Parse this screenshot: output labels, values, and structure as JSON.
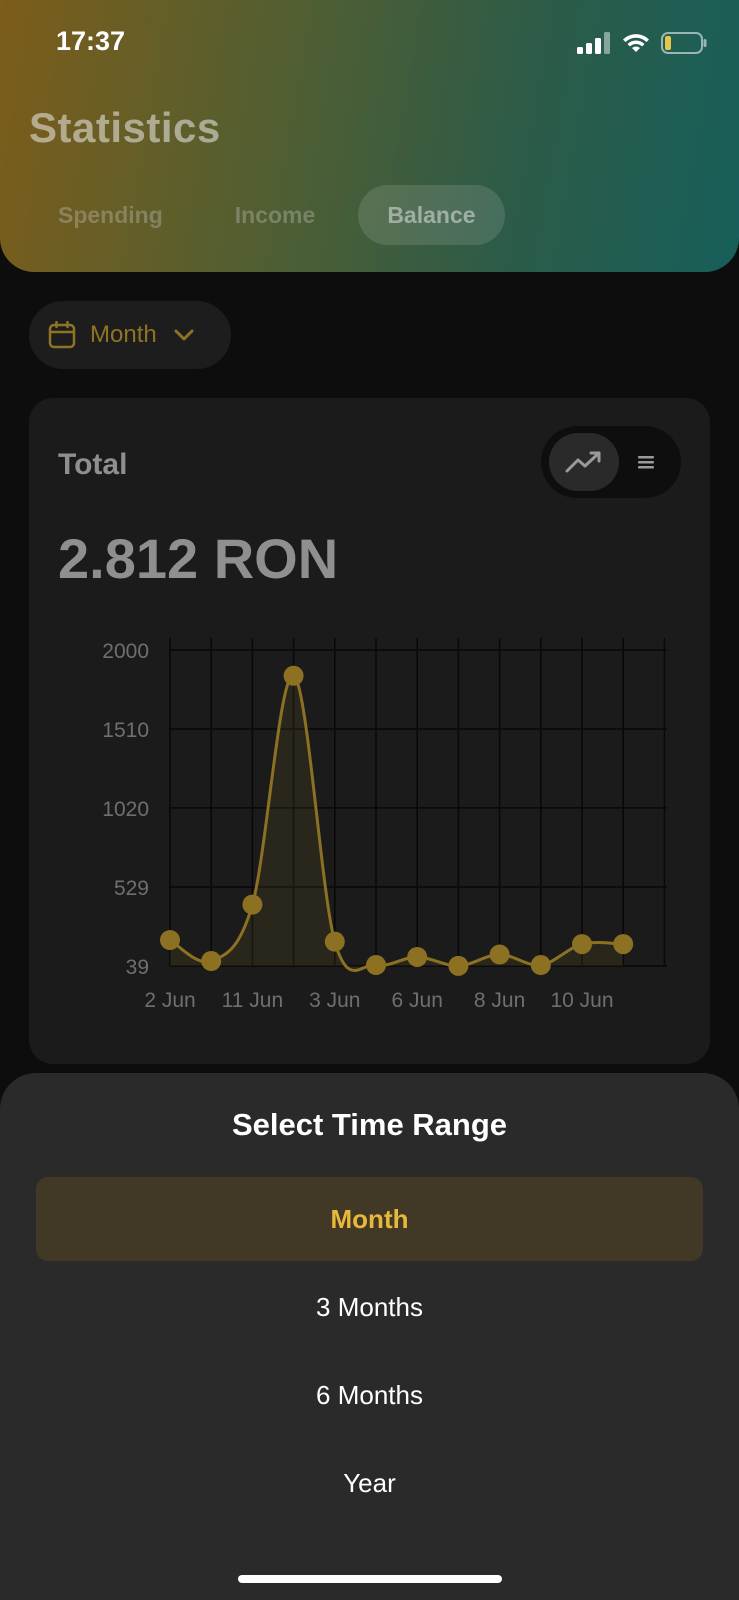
{
  "status_bar": {
    "time": "17:37",
    "icons": [
      "signal-icon",
      "wifi-icon",
      "battery-icon"
    ],
    "battery_color": "#e6c64a"
  },
  "header": {
    "title": "Statistics",
    "tabs": [
      {
        "label": "Spending",
        "active": false
      },
      {
        "label": "Income",
        "active": false
      },
      {
        "label": "Balance",
        "active": true
      }
    ]
  },
  "range_button": {
    "label": "Month",
    "icon": "calendar-icon",
    "chevron": "chevron-down-icon"
  },
  "card": {
    "title": "Total",
    "total_value": "2.812 RON",
    "view_toggle": [
      {
        "icon": "trend-line-icon",
        "active": true
      },
      {
        "icon": "list-icon",
        "active": false
      }
    ]
  },
  "chart_data": {
    "type": "line",
    "y_ticks": [
      39,
      529,
      1020,
      1510,
      2000
    ],
    "ylim": [
      39,
      2000
    ],
    "x_tick_labels": [
      "2 Jun",
      "11 Jun",
      "3 Jun",
      "6 Jun",
      "8 Jun",
      "10 Jun"
    ],
    "values": [
      200,
      70,
      420,
      1840,
      190,
      45,
      95,
      40,
      110,
      45,
      175,
      175
    ],
    "line_color": "#8c7123",
    "grid": true
  },
  "sheet": {
    "title": "Select Time Range",
    "options": [
      {
        "label": "Month",
        "selected": true
      },
      {
        "label": "3 Months",
        "selected": false
      },
      {
        "label": "6 Months",
        "selected": false
      },
      {
        "label": "Year",
        "selected": false
      }
    ],
    "accent": "#e8b83a"
  }
}
